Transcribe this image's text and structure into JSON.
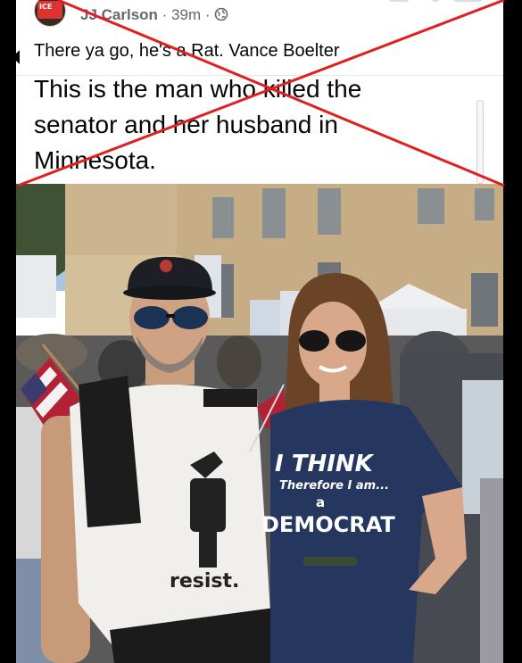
{
  "post": {
    "author": "JJ Carlson",
    "time": "· 39m ·",
    "caption": "There ya go, he's a Rat. Vance Boelter",
    "headline_lines": [
      "This is the man who killed the",
      "senator and her husband in",
      "Minnesota."
    ]
  },
  "photo": {
    "shirt_man_word": "resist.",
    "shirt_woman_lines": [
      "I THINK",
      "Therefore I am...",
      "a",
      "DEMOCRAT"
    ]
  },
  "colors": {
    "cross": "#e02020",
    "shirt_woman": "#24365f",
    "shirt_man": "#f2f0ec",
    "sky": "#9fbfdc",
    "building": "#cdb68f"
  },
  "icons": [
    "globe-icon"
  ]
}
